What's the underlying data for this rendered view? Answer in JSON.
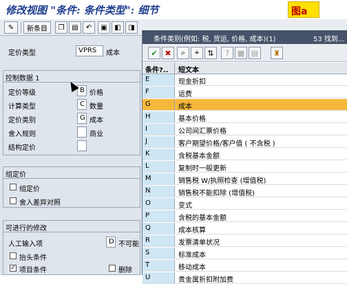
{
  "title": "修改视图 \"条件: 条件类型\": 细节",
  "figure_label": "图a",
  "toolbar": {
    "pencil_icon": "pencil-icon",
    "new_entries_label": "新条目"
  },
  "form": {
    "pricing_type_label": "定价类型",
    "pricing_type_code": "VPRS",
    "pricing_type_desc": "成本",
    "control_section_title": "控制数据 1",
    "fields": [
      {
        "label": "定价等级",
        "code": "B",
        "value": "价格"
      },
      {
        "label": "计算类型",
        "code": "C",
        "value": "数量"
      },
      {
        "label": "定价类别",
        "code": "G",
        "value": "成本"
      },
      {
        "label": "舍入规则",
        "code": "",
        "value": "商业"
      },
      {
        "label": "结构定价",
        "code": "",
        "value": ""
      }
    ],
    "group_section_title": "组定价",
    "group_pricing_label": "组定价",
    "rounding_diff_label": "舍入差异对照",
    "modify_section_title": "可进行的修改",
    "manual_entry_label": "人工输入项",
    "manual_entry_code": "D",
    "manual_entry_value": "不可能",
    "header_condition_label": "抬头条件",
    "item_condition_label": "项目条件",
    "item_condition_checked": true,
    "delete_label": "删除"
  },
  "popup": {
    "title": "条件类别(例如: 税, 货运, 价格, 成本)(1)",
    "count": "53 找到...",
    "col_key": "条件?..",
    "col_text": "短文本",
    "rows": [
      {
        "key": "E",
        "text": "现金折扣"
      },
      {
        "key": "F",
        "text": "运费"
      },
      {
        "key": "G",
        "text": "成本",
        "selected": true
      },
      {
        "key": "H",
        "text": "基本价格"
      },
      {
        "key": "I",
        "text": "公司间汇票价格"
      },
      {
        "key": "J",
        "text": "客户期望价格/客户值 ( 不含税 )"
      },
      {
        "key": "K",
        "text": "含税基本金额"
      },
      {
        "key": "L",
        "text": "复制时一般更新"
      },
      {
        "key": "M",
        "text": "销售税 W/执照检查 (增值税)"
      },
      {
        "key": "N",
        "text": "销售税不能扣除 (增值税)"
      },
      {
        "key": "O",
        "text": "变式"
      },
      {
        "key": "P",
        "text": "含税的基本金额"
      },
      {
        "key": "Q",
        "text": "成本核算"
      },
      {
        "key": "R",
        "text": "发票清单状况"
      },
      {
        "key": "S",
        "text": "标准成本"
      },
      {
        "key": "T",
        "text": "移动成本"
      },
      {
        "key": "U",
        "text": "贵金属折扣附加费"
      }
    ]
  },
  "colors": {
    "selected_row": "#f5b83a",
    "popup_title_bar": "#46536a",
    "key_column": "#cfe6f5"
  }
}
